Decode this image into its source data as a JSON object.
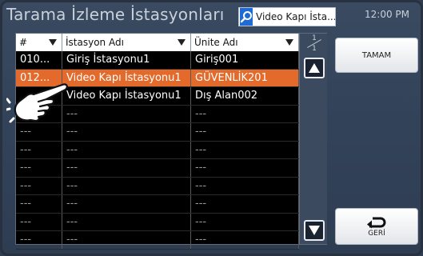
{
  "header": {
    "title": "Tarama İzleme İstasyonları",
    "search_value": "Video Kapı İsta...",
    "clock": "12:00 PM"
  },
  "table": {
    "columns": [
      "#",
      "İstasyon Adı",
      "Ünite Adı"
    ],
    "rows": [
      [
        "010...",
        "Giriş İstasyonu1",
        "Giriş001"
      ],
      [
        "012...",
        "Video Kapı İstasyonu1",
        "GÜVENLİK201"
      ],
      [
        "",
        "Video Kapı İstasyonu1",
        "Dış Alan002"
      ],
      [
        "---",
        "---",
        "---"
      ],
      [
        "---",
        "---",
        "---"
      ],
      [
        "---",
        "---",
        "---"
      ],
      [
        "---",
        "---",
        "---"
      ],
      [
        "---",
        "---",
        "---"
      ],
      [
        "---",
        "---",
        "---"
      ],
      [
        "---",
        "---",
        "---"
      ],
      [
        "---",
        "---",
        "---"
      ]
    ],
    "selected_row": 1,
    "page_current": "1",
    "page_total": "1"
  },
  "buttons": {
    "ok_label": "TAMAM",
    "back_label": "GERİ"
  },
  "colors": {
    "selected_row": "#e36a2b",
    "background": "#2f3e52",
    "search_icon_bg": "#1f6bd6"
  },
  "icons": {
    "search": "search-icon",
    "scroll_up": "arrow-up-icon",
    "scroll_down": "arrow-down-icon",
    "back": "return-arrow-icon",
    "pointer": "hand-pointer-icon",
    "sort": "sort-down-triangle-icon"
  }
}
